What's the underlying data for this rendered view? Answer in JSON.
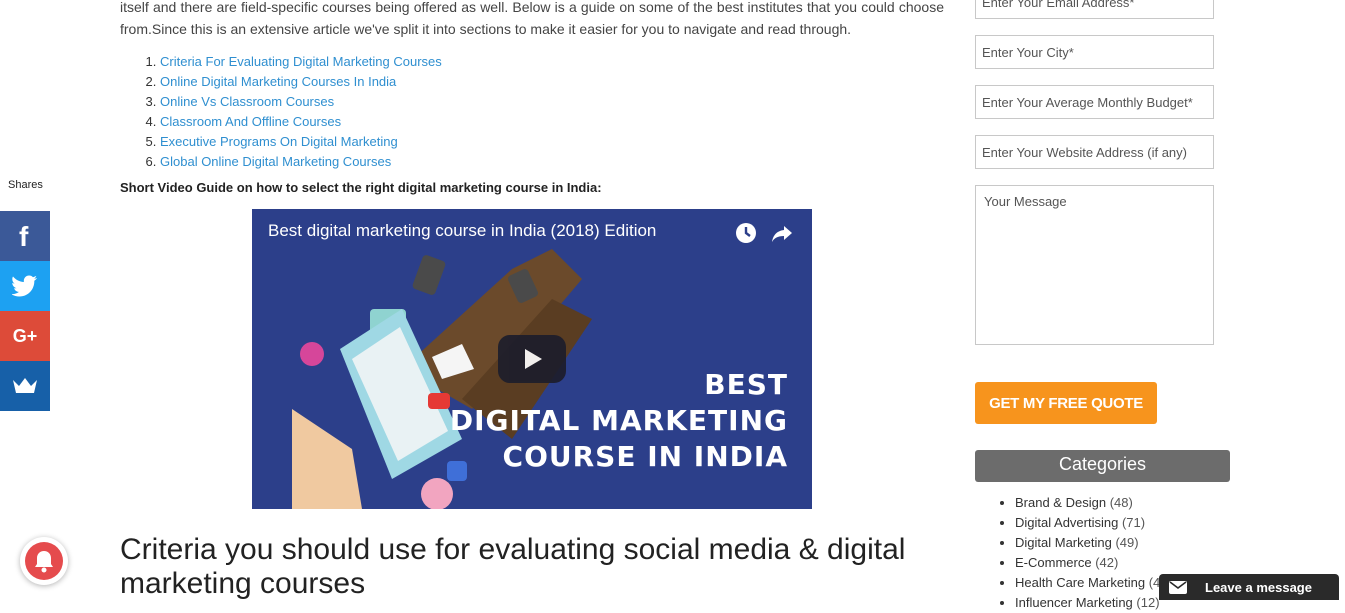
{
  "article": {
    "intro": "itself and there are field-specific courses being offered as well. Below is a guide on some of the best institutes that you could choose from.Since this is an extensive article we've split it into sections to make it easier for you to navigate and read through.",
    "toc": [
      "Criteria For Evaluating Digital Marketing Courses",
      "Online Digital Marketing Courses In India",
      " Online Vs Classroom Courses",
      "Classroom And Offline Courses",
      "Executive Programs On Digital Marketing",
      "Global Online Digital Marketing Courses"
    ],
    "video_caption": "Short Video Guide on how to select the right digital marketing course in India:",
    "video": {
      "title": "Best digital marketing course in India (2018) Edition",
      "headline_line1": "BEST",
      "headline_line2": "DIGITAL MARKETING",
      "headline_line3": "COURSE IN INDIA"
    },
    "section_title": "Criteria you should use for evaluating social media & digital marketing courses"
  },
  "share": {
    "label": "Shares",
    "buttons": [
      {
        "name": "facebook",
        "glyph": "f",
        "color": "#3b5998"
      },
      {
        "name": "twitter",
        "glyph": "",
        "color": "#1da1f2"
      },
      {
        "name": "google-plus",
        "glyph": "G+",
        "color": "#dd4b39"
      },
      {
        "name": "sumo",
        "glyph": "",
        "color": "#1760a8"
      }
    ]
  },
  "form": {
    "email_placeholder": "Enter Your Email Address*",
    "city_placeholder": "Enter Your City*",
    "budget_placeholder": "Enter Your Average Monthly Budget*",
    "website_placeholder": "Enter Your Website Address (if any)",
    "message_placeholder": "Your Message",
    "submit_label": "GET MY FREE QUOTE"
  },
  "categories": {
    "title": "Categories",
    "items": [
      {
        "label": "Brand & Design",
        "count": "(48)"
      },
      {
        "label": "Digital Advertising",
        "count": "(71)"
      },
      {
        "label": "Digital Marketing",
        "count": "(49)"
      },
      {
        "label": "E-Commerce",
        "count": "(42)"
      },
      {
        "label": "Health Care Marketing",
        "count": "(4"
      },
      {
        "label": "Influencer Marketing",
        "count": "(12)"
      }
    ]
  },
  "message_widget": {
    "label": "Leave a message"
  },
  "colors": {
    "accent": "#f7941d",
    "link": "#2f8fd0",
    "video_bg": "#2c3f8a"
  }
}
